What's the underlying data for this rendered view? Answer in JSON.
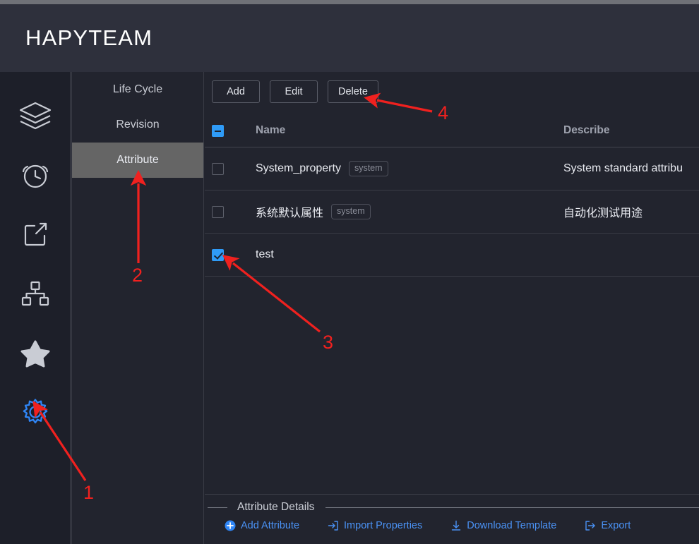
{
  "header": {
    "brand": "HAPYTEAM"
  },
  "sidebar": {
    "items": [
      {
        "icon": "layers-icon",
        "name": "sidebar-item-layers"
      },
      {
        "icon": "alarm-clock-icon",
        "name": "sidebar-item-schedule"
      },
      {
        "icon": "share-icon",
        "name": "sidebar-item-share"
      },
      {
        "icon": "sitemap-icon",
        "name": "sidebar-item-structure"
      },
      {
        "icon": "star-icon",
        "name": "sidebar-item-favorites"
      },
      {
        "icon": "gear-icon",
        "name": "sidebar-item-settings",
        "active": true
      }
    ],
    "active_color": "#2f86f7"
  },
  "tabs": [
    {
      "label": "Life Cycle",
      "active": false
    },
    {
      "label": "Revision",
      "active": false
    },
    {
      "label": "Attribute",
      "active": true
    }
  ],
  "toolbar": {
    "add_label": "Add",
    "edit_label": "Edit",
    "delete_label": "Delete"
  },
  "table": {
    "columns": {
      "name": "Name",
      "describe": "Describe"
    },
    "header_checkbox_state": "indeterminate",
    "rows": [
      {
        "checked": false,
        "name": "System_property",
        "badge": "system",
        "describe": "System standard attribu"
      },
      {
        "checked": false,
        "name": "系统默认属性",
        "badge": "system",
        "describe": "自动化测试用途"
      },
      {
        "checked": true,
        "name": "test",
        "badge": "",
        "describe": ""
      }
    ]
  },
  "details": {
    "title": "Attribute Details",
    "actions": [
      {
        "label": "Add Attribute",
        "icon": "circle-plus-icon"
      },
      {
        "label": "Import Properties",
        "icon": "import-icon"
      },
      {
        "label": "Download Template",
        "icon": "download-icon"
      },
      {
        "label": "Export",
        "icon": "export-icon"
      }
    ],
    "link_color": "#4a92f5"
  },
  "annotations": {
    "color": "#f0211f",
    "markers": [
      {
        "number": "1",
        "target": "gear-icon"
      },
      {
        "number": "2",
        "target": "tab-attribute"
      },
      {
        "number": "3",
        "target": "row-test-checkbox"
      },
      {
        "number": "4",
        "target": "delete-button"
      }
    ]
  }
}
